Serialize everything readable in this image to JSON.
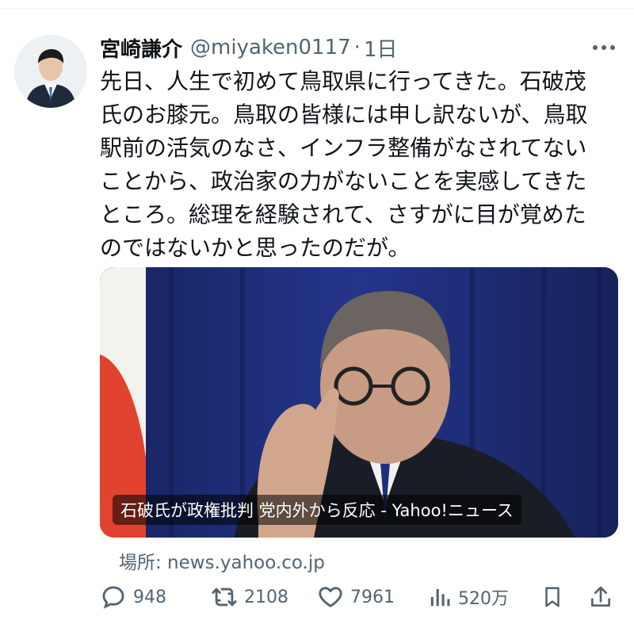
{
  "tweet": {
    "author": {
      "display_name": "宮崎謙介",
      "handle": "@miyaken0117",
      "separator": "·",
      "time": "1日"
    },
    "text_lines": [
      "先日、人生で初めて鳥取県に行ってきた。石破茂",
      "氏のお膝元。鳥取の皆様には申し訳ないが、鳥取",
      "駅前の活気のなさ、インフラ整備がなされてない",
      "ことから、政治家の力がないことを実感してきた",
      "ところ。総理を経験されて、さすがに目が覚めた",
      "のではないかと思ったのだが。"
    ],
    "card": {
      "caption": "石破氏が政権批判 党内外から反応 - Yahoo!ニュース",
      "source": "場所: news.yahoo.co.jp"
    },
    "metrics": {
      "replies": "948",
      "retweets": "2108",
      "likes": "7961",
      "views": "520万"
    }
  },
  "icons": {
    "more": "more-horizontal-icon",
    "reply": "reply-icon",
    "retweet": "retweet-icon",
    "like": "heart-icon",
    "views": "views-chart-icon",
    "bookmark": "bookmark-icon",
    "share": "share-icon"
  },
  "colors": {
    "text_primary": "#0f1419",
    "text_secondary": "#536471",
    "card_background": "#1d2a6b"
  }
}
